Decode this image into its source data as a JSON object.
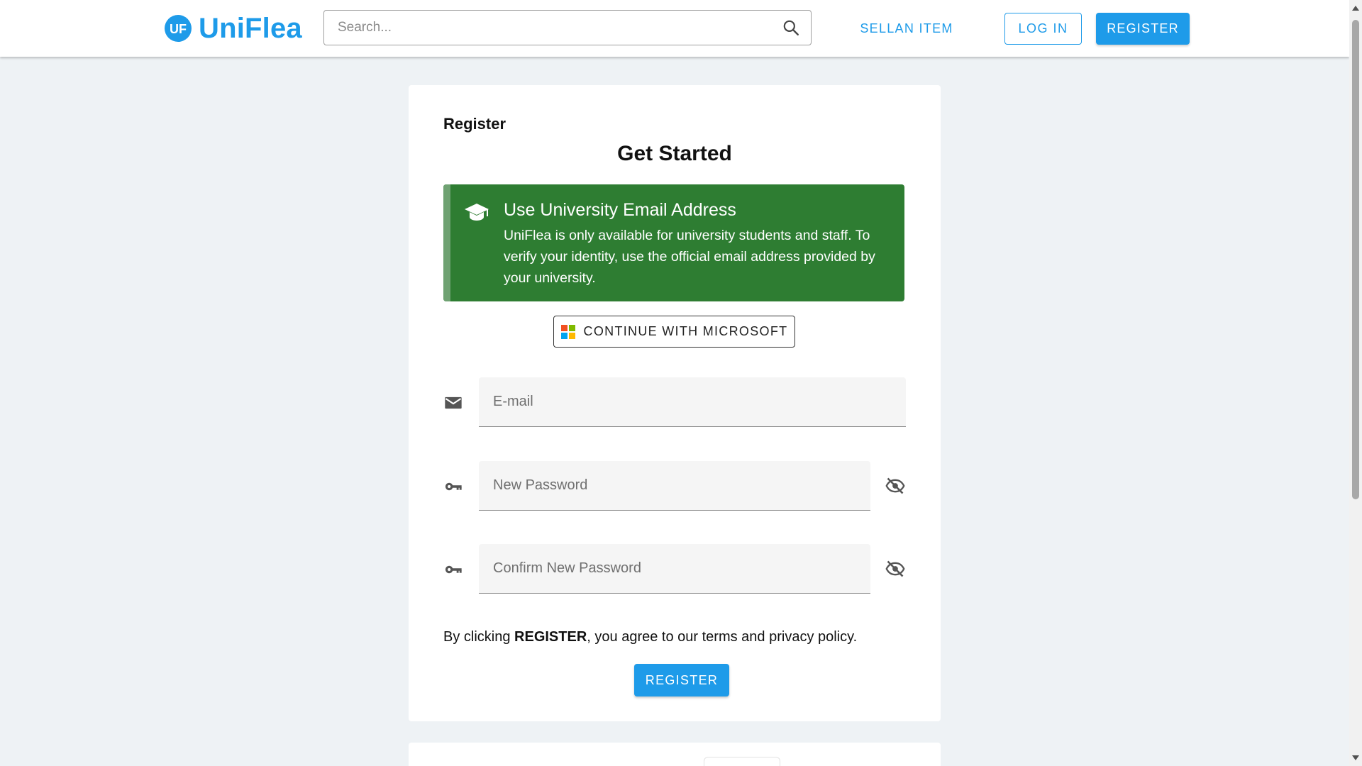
{
  "header": {
    "brand": "UniFlea",
    "brand_mark": "UF",
    "search_placeholder": "Search...",
    "sell_label": "SELLAN ITEM",
    "login_label": "LOG IN",
    "register_label": "REGISTER"
  },
  "card": {
    "title": "Register",
    "heading": "Get Started",
    "alert": {
      "title": "Use University Email Address",
      "body": "UniFlea is only available for university students and staff. To verify your identity, use the official email address provided by your university.",
      "icon": "graduation-cap-icon"
    },
    "microsoft_button": "CONTINUE WITH MICROSOFT",
    "fields": {
      "email_placeholder": "E-mail",
      "new_password_placeholder": "New Password",
      "confirm_password_placeholder": "Confirm New Password"
    },
    "terms": {
      "prefix": "By clicking ",
      "emphasis": "REGISTER",
      "suffix": ", you agree to our terms and privacy policy."
    },
    "register_button": "REGISTER"
  },
  "colors": {
    "primary": "#1e9be9",
    "alert_bg": "#2e7d32",
    "page_bg": "#eef2f5"
  }
}
